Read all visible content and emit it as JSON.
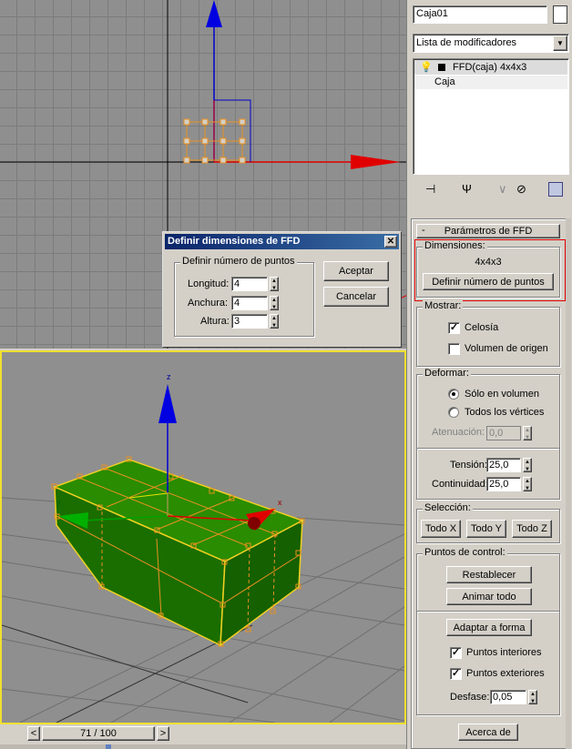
{
  "panel": {
    "object_name": "Caja01",
    "modifier_list_label": "Lista de modificadores",
    "stack": [
      {
        "label": "FFD(caja) 4x4x3"
      },
      {
        "label": "Caja"
      }
    ]
  },
  "rollout": {
    "title": "Parámetros de FFD",
    "dimensions": {
      "group": "Dimensiones:",
      "value": "4x4x3",
      "set_button": "Definir número de puntos"
    },
    "display": {
      "group": "Mostrar:",
      "lattice": {
        "label": "Celosía",
        "checked": true
      },
      "source_volume": {
        "label": "Volumen de origen",
        "checked": false
      }
    },
    "deform": {
      "group": "Deformar:",
      "only_in_volume": {
        "label": "Sólo en volumen",
        "selected": true
      },
      "all_vertices": {
        "label": "Todos los vértices",
        "selected": false
      },
      "falloff": {
        "label": "Atenuación:",
        "value": "0,0"
      },
      "tension": {
        "label": "Tensión:",
        "value": "25,0"
      },
      "continuity": {
        "label": "Continuidad:",
        "value": "25,0"
      }
    },
    "selection": {
      "group": "Selección:",
      "all_x": "Todo X",
      "all_y": "Todo Y",
      "all_z": "Todo Z"
    },
    "control_points": {
      "group": "Puntos de control:",
      "reset": "Restablecer",
      "animate_all": "Animar todo",
      "conform": "Adaptar a forma",
      "inside_points": {
        "label": "Puntos interiores",
        "checked": true
      },
      "outside_points": {
        "label": "Puntos exteriores",
        "checked": true
      },
      "offset": {
        "label": "Desfase:",
        "value": "0,05"
      }
    },
    "about_button": "Acerca de"
  },
  "dialog": {
    "title": "Definir dimensiones de FFD",
    "group": "Definir número de puntos",
    "length": {
      "label": "Longitud:",
      "value": "4"
    },
    "width": {
      "label": "Anchura:",
      "value": "4"
    },
    "height": {
      "label": "Altura:",
      "value": "3"
    },
    "ok": "Aceptar",
    "cancel": "Cancelar"
  },
  "timeline": {
    "frame": "71 / 100"
  },
  "viewport": {
    "axis_x": "x",
    "axis_y": "y",
    "axis_z": "z"
  },
  "colors": {
    "box_green": "#1a7a00",
    "lattice_orange": "#e89020",
    "highlight_red": "#e00000",
    "active_border": "#f0e030"
  }
}
